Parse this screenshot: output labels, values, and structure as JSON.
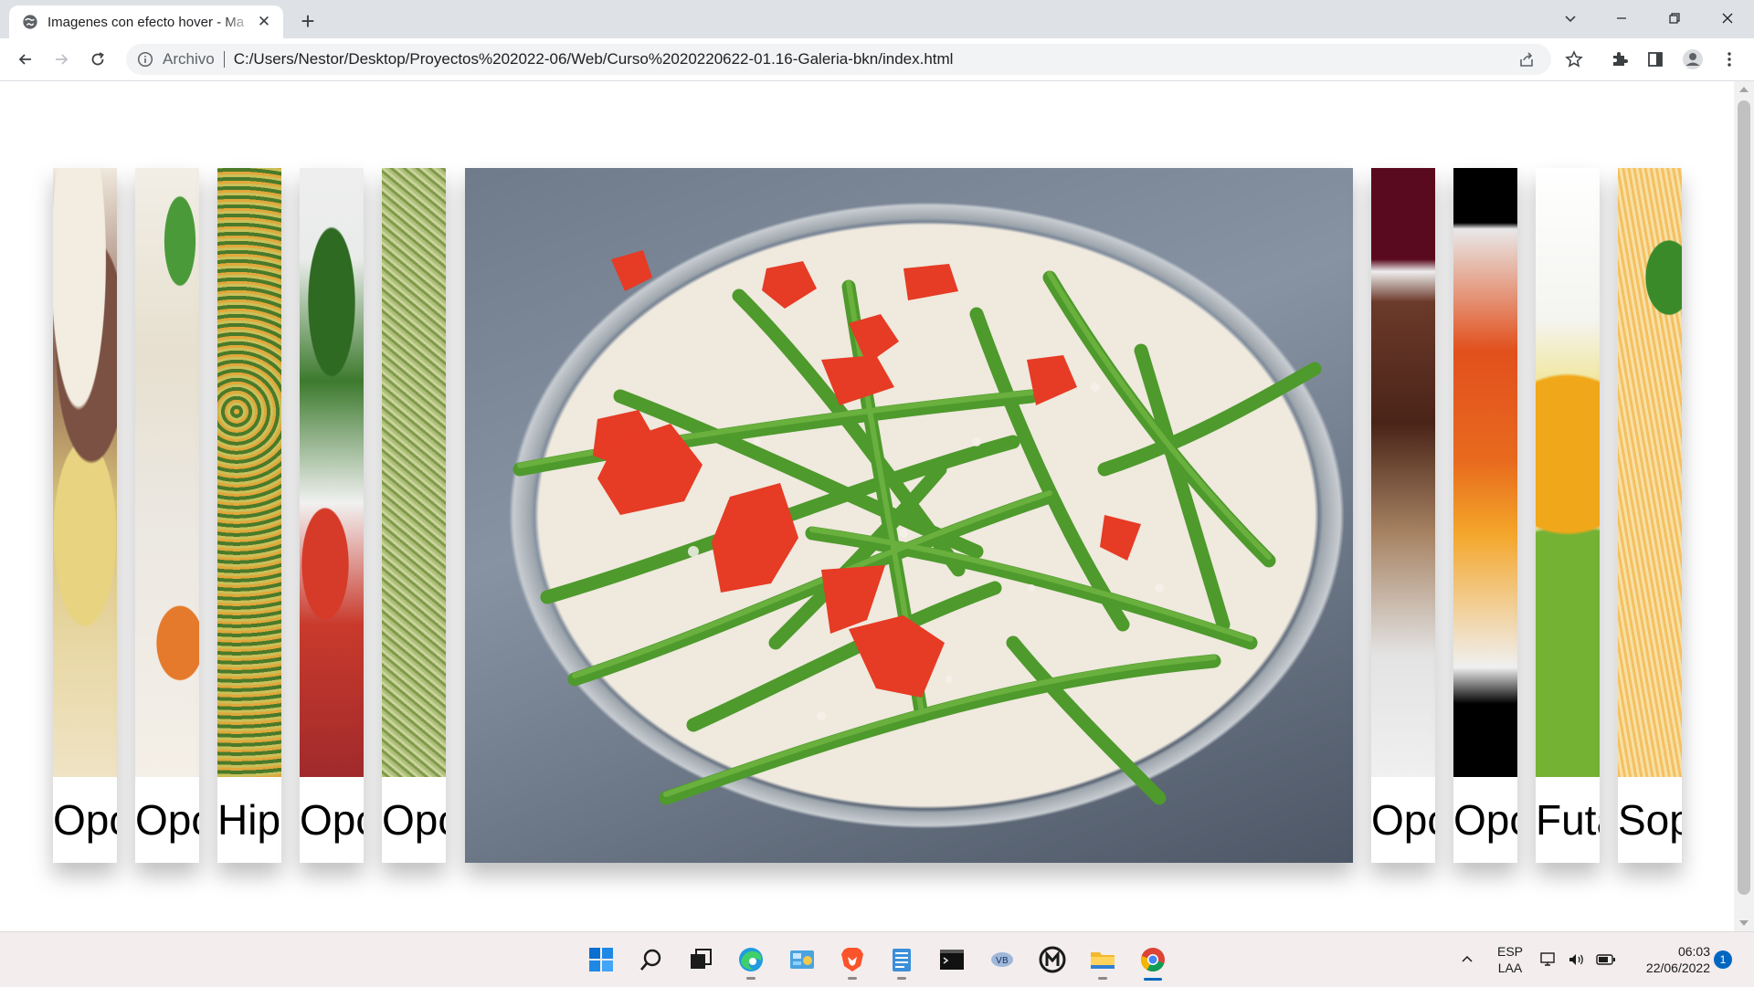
{
  "browser": {
    "tab_title": "Imagenes con efecto hover - Ma",
    "tab_close": "✕",
    "new_tab": "+",
    "omnibox_label": "Archivo",
    "url": "C:/Users/Nestor/Desktop/Proyectos%202022-06/Web/Curso%2020220622-01.16-Galeria-bkn/index.html"
  },
  "gallery": {
    "cards": [
      {
        "caption": "Opc",
        "image": "steak-potatoes"
      },
      {
        "caption": "Opc",
        "image": "rice-chicken"
      },
      {
        "caption": "Hip",
        "image": "mixed-vegetables"
      },
      {
        "caption": "Opc",
        "image": "tomato-cilantro-salad"
      },
      {
        "caption": "Opc",
        "image": "cabbage-salad"
      },
      {
        "caption": "",
        "image": "green-beans-tomato",
        "hovered": true
      },
      {
        "caption": "Opc",
        "image": "chocolate-cake"
      },
      {
        "caption": "Opc",
        "image": "squash-soup"
      },
      {
        "caption": "Futa",
        "image": "fruits"
      },
      {
        "caption": "Sop",
        "image": "noodle-soup"
      }
    ]
  },
  "taskbar": {
    "language": "ESP",
    "layout": "LAA",
    "time": "06:03",
    "date": "22/06/2022",
    "notifications": "1"
  }
}
